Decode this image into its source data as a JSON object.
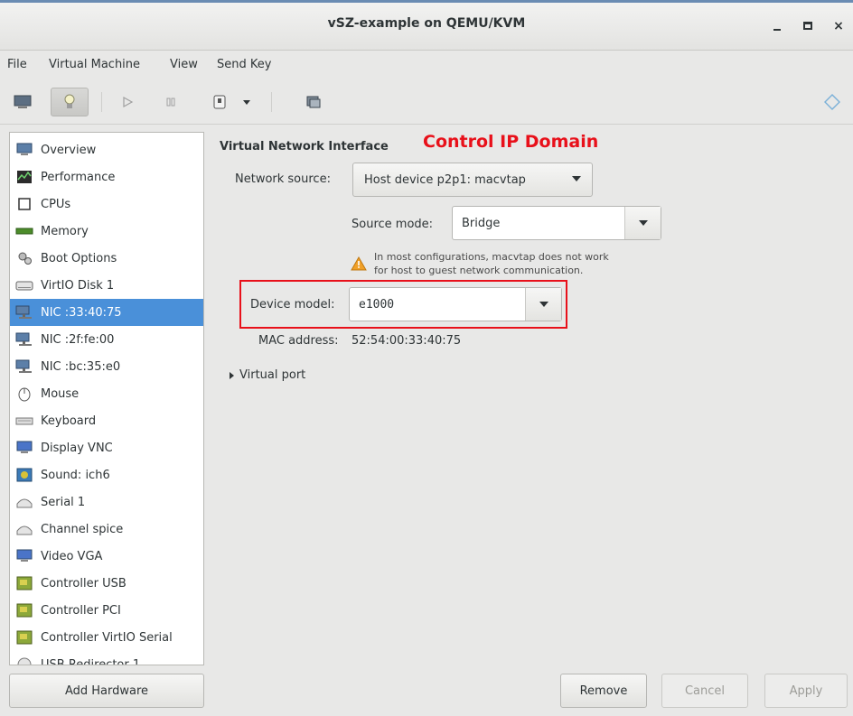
{
  "window": {
    "title": "vSZ-example on QEMU/KVM"
  },
  "menubar": {
    "items": [
      "File",
      "Virtual Machine",
      "View",
      "Send Key"
    ]
  },
  "toolbar": {
    "buttons": [
      "monitor-icon",
      "lightbulb-icon",
      "play-icon",
      "pause-icon",
      "power-icon",
      "chevron-down-icon",
      "screenshot-icon",
      "resize-icon"
    ]
  },
  "sidebar": {
    "items": [
      {
        "label": "Overview",
        "icon": "monitor-icon"
      },
      {
        "label": "Performance",
        "icon": "graph-icon"
      },
      {
        "label": "CPUs",
        "icon": "cpu-icon"
      },
      {
        "label": "Memory",
        "icon": "memory-icon"
      },
      {
        "label": "Boot Options",
        "icon": "gears-icon"
      },
      {
        "label": "VirtIO Disk 1",
        "icon": "disk-icon"
      },
      {
        "label": "NIC :33:40:75",
        "icon": "network-icon"
      },
      {
        "label": "NIC :2f:fe:00",
        "icon": "network-icon"
      },
      {
        "label": "NIC :bc:35:e0",
        "icon": "network-icon"
      },
      {
        "label": "Mouse",
        "icon": "mouse-icon"
      },
      {
        "label": "Keyboard",
        "icon": "keyboard-icon"
      },
      {
        "label": "Display VNC",
        "icon": "display-icon"
      },
      {
        "label": "Sound: ich6",
        "icon": "sound-icon"
      },
      {
        "label": "Serial 1",
        "icon": "serial-icon"
      },
      {
        "label": "Channel spice",
        "icon": "channel-icon"
      },
      {
        "label": "Video VGA",
        "icon": "video-icon"
      },
      {
        "label": "Controller USB",
        "icon": "controller-icon"
      },
      {
        "label": "Controller PCI",
        "icon": "controller-icon"
      },
      {
        "label": "Controller VirtIO Serial",
        "icon": "controller-icon"
      },
      {
        "label": "USB Redirector 1",
        "icon": "usb-icon"
      }
    ],
    "selected_index": 6,
    "add_hardware_label": "Add Hardware"
  },
  "details": {
    "heading": "Virtual Network Interface",
    "annotation": "Control IP Domain",
    "network_source_label": "Network source:",
    "network_source_value": "Host device p2p1: macvtap",
    "source_mode_label": "Source mode:",
    "source_mode_value": "Bridge",
    "warning_line1": "In most configurations, macvtap does not work",
    "warning_line2": "for host to guest network communication.",
    "device_model_label": "Device model:",
    "device_model_value": "e1000",
    "mac_address_label": "MAC address:",
    "mac_address_value": "52:54:00:33:40:75",
    "virtual_port_label": "Virtual port"
  },
  "footer": {
    "remove_label": "Remove",
    "cancel_label": "Cancel",
    "apply_label": "Apply"
  },
  "colors": {
    "selection": "#4a90d9",
    "annotation": "#e8101a"
  }
}
